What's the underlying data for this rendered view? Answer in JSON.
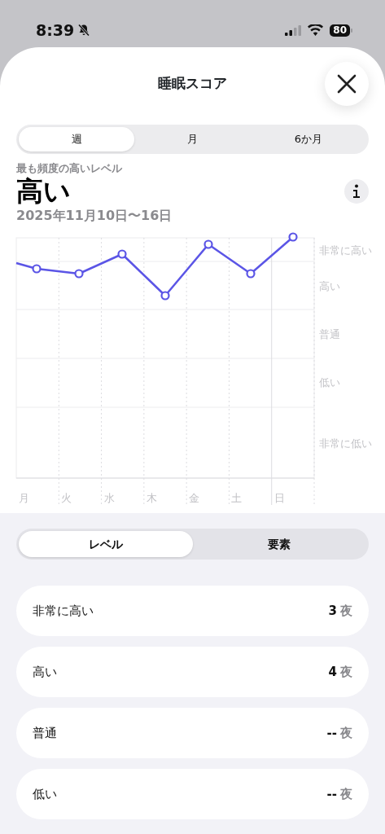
{
  "status_bar": {
    "time": "8:39",
    "battery": "80"
  },
  "sheet": {
    "title": "睡眠スコア"
  },
  "period_tabs": [
    {
      "label": "週",
      "selected": true
    },
    {
      "label": "月",
      "selected": false
    },
    {
      "label": "6か月",
      "selected": false
    }
  ],
  "summary": {
    "caption": "最も頻度の高いレベル",
    "value": "高い",
    "date_range": "2025年11月10日〜16日"
  },
  "chart": {
    "y_labels": [
      "非常に高い",
      "高い",
      "普通",
      "低い",
      "非常に低い"
    ],
    "x_labels": [
      "月",
      "火",
      "水",
      "木",
      "金",
      "土",
      "日"
    ]
  },
  "view_tabs": [
    {
      "label": "レベル",
      "selected": true
    },
    {
      "label": "要素",
      "selected": false
    }
  ],
  "levels": [
    {
      "label": "非常に高い",
      "value": "3",
      "unit": "夜"
    },
    {
      "label": "高い",
      "value": "4",
      "unit": "夜"
    },
    {
      "label": "普通",
      "value": "--",
      "unit": "夜"
    },
    {
      "label": "低い",
      "value": "--",
      "unit": "夜"
    }
  ]
}
